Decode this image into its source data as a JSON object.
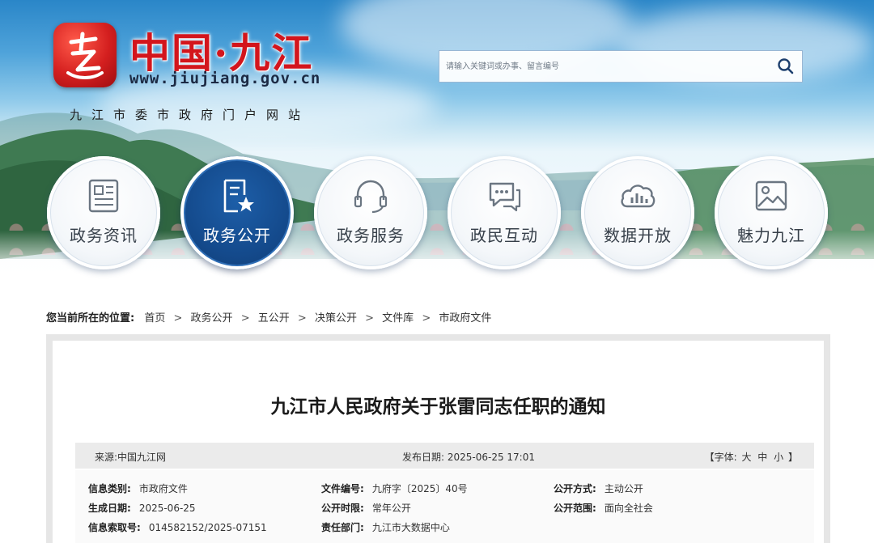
{
  "site": {
    "title": "中国·九江",
    "url": "www.jiujiang.gov.cn",
    "subtitle": "九江市委市政府门户网站",
    "brand_red": "#d3151c",
    "nav_active_color": "#144a8c"
  },
  "search": {
    "placeholder": "请输入关键词或办事、留言编号",
    "button_icon": "search-icon"
  },
  "nav": {
    "items": [
      {
        "label": "政务资讯",
        "icon": "newspaper-icon",
        "active": false
      },
      {
        "label": "政务公开",
        "icon": "document-star-icon",
        "active": true
      },
      {
        "label": "政务服务",
        "icon": "headset-icon",
        "active": false
      },
      {
        "label": "政民互动",
        "icon": "chat-bubble-icon",
        "active": false
      },
      {
        "label": "数据开放",
        "icon": "cloud-chart-icon",
        "active": false
      },
      {
        "label": "魅力九江",
        "icon": "picture-icon",
        "active": false
      }
    ]
  },
  "breadcrumb": {
    "label": "您当前所在的位置:",
    "items": [
      "首页",
      "政务公开",
      "五公开",
      "决策公开",
      "文件库",
      "市政府文件"
    ],
    "separator": ">"
  },
  "article": {
    "title": "九江市人民政府关于张雷同志任职的通知",
    "source": "来源:中国九江网",
    "publish_date": "发布日期: 2025-06-25 17:01",
    "font_label": "【字体:",
    "font_options": [
      "大",
      "中",
      "小"
    ],
    "font_close": "】"
  },
  "info": {
    "category_key": "信息类别:",
    "category_val": "市政府文件",
    "doc_no_key": "文件编号:",
    "doc_no_val": "九府字〔2025〕40号",
    "method_key": "公开方式:",
    "method_val": "主动公开",
    "created_key": "生成日期:",
    "created_val": "2025-06-25",
    "period_key": "公开时限:",
    "period_val": "常年公开",
    "scope_key": "公开范围:",
    "scope_val": "面向全社会",
    "index_key": "信息索取号:",
    "index_val": "014582152/2025-07151",
    "dept_key": "责任部门:",
    "dept_val": "九江市大数据中心"
  }
}
